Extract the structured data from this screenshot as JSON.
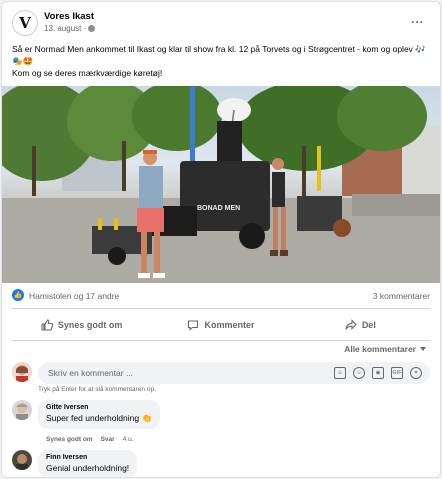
{
  "post": {
    "page_name": "Vores Ikast",
    "logo_text": "V",
    "timestamp": "13. august ·",
    "text_line1": "Så er Normad Men ankommet til Ikast og klar til show fra kl. 12 på Torvets og i Strøgcentret - kom og oplev 🎶🎭🤩",
    "text_line2": "Kom og se deres mærkværdige køretøj!",
    "photo_vehicle_text": "BONAD MEN",
    "more_label": "..."
  },
  "stats": {
    "likers": "Hamistolen og 17 andre",
    "comment_count": "3 kommentarer"
  },
  "actions": {
    "like": "Synes godt om",
    "comment": "Kommenter",
    "share": "Del"
  },
  "comments_section": {
    "sort_label": "Alle kommentarer",
    "input_placeholder": "Skriv en kommentar ...",
    "input_hint": "Tryk på Enter for at slå kommentaren op.",
    "input_icons": [
      "smiley-sticker-icon",
      "emoji-icon",
      "camera-icon",
      "gif-icon",
      "sticker-icon"
    ],
    "gif_text": "GIF",
    "comments": [
      {
        "author": "Gitte Iversen",
        "text": "Super fed underholdning 👏",
        "like_label": "Synes godt om",
        "reply_label": "Svar",
        "age": "4 u."
      },
      {
        "author": "Finn Iversen",
        "text": "Genial underholdning!"
      }
    ]
  },
  "colors": {
    "accent": "#1877f2",
    "secondary_text": "#65676b",
    "bubble_bg": "#f0f2f5"
  }
}
